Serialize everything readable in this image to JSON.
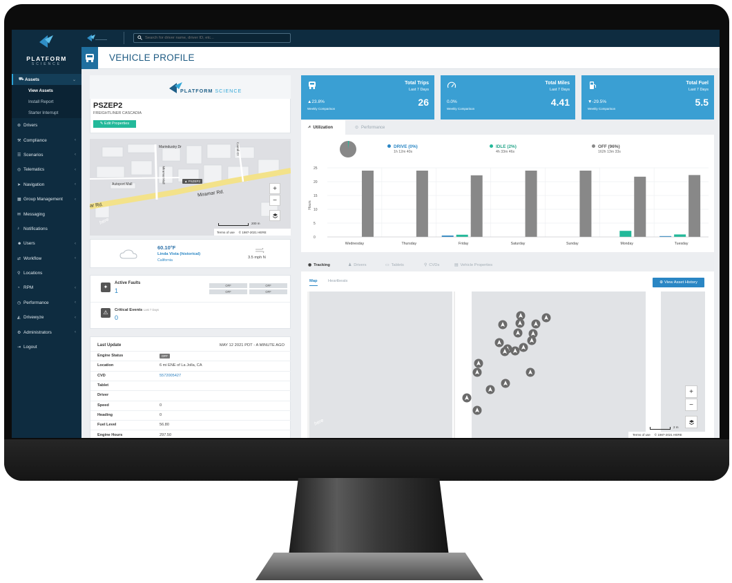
{
  "brand": {
    "title": "PLATFORM",
    "subtitle": "SCIENCE",
    "banner_main": "PLATFORM",
    "banner_accent": "SCIENCE"
  },
  "topbar": {
    "search_placeholder": "Search for driver name, driver ID, etc..."
  },
  "sidebar": {
    "items": [
      {
        "label": "Assets",
        "icon": "truck-icon",
        "chevron": "⌄"
      },
      {
        "label": "Drivers",
        "icon": "steering-icon",
        "chevron": ""
      },
      {
        "label": "Compliance",
        "icon": "gavel-icon",
        "chevron": "‹"
      },
      {
        "label": "Scenarios",
        "icon": "list-icon",
        "chevron": "‹"
      },
      {
        "label": "Telematics",
        "icon": "signal-icon",
        "chevron": "‹"
      },
      {
        "label": "Navigation",
        "icon": "navigation-icon",
        "chevron": "‹"
      },
      {
        "label": "Group Management",
        "icon": "grid-icon",
        "chevron": "‹"
      },
      {
        "label": "Messaging",
        "icon": "chat-icon",
        "chevron": ""
      },
      {
        "label": "Notifications",
        "icon": "bell-icon",
        "chevron": ""
      },
      {
        "label": "Users",
        "icon": "users-icon",
        "chevron": "‹"
      },
      {
        "label": "Workflow",
        "icon": "workflow-icon",
        "chevron": "‹"
      },
      {
        "label": "Locations",
        "icon": "pin-icon",
        "chevron": ""
      },
      {
        "label": "RPM",
        "icon": "gauge-icon",
        "chevron": "‹"
      },
      {
        "label": "Performance",
        "icon": "performance-icon",
        "chevron": "‹"
      },
      {
        "label": "Drivewyze",
        "icon": "drivewyze-icon",
        "chevron": "‹"
      },
      {
        "label": "Administrators",
        "icon": "admin-icon",
        "chevron": "‹"
      },
      {
        "label": "Logout",
        "icon": "logout-icon",
        "chevron": ""
      }
    ],
    "sub_items": [
      "View Assets",
      "Install Report",
      "Starter Interrupt"
    ]
  },
  "page": {
    "title": "VEHICLE PROFILE"
  },
  "vehicle": {
    "name": "PSZEP2",
    "model": "FREIGHTLINER CASCADIA",
    "edit_label": "Edit Properties"
  },
  "small_map": {
    "labels": [
      "Marindustry Dr",
      "Autoport Mall",
      "Miramar Rd.",
      "ar Rd.",
      "Carroll Ct",
      "Miramar Mall"
    ],
    "marker": "PSZEP2",
    "scale": "200 m",
    "terms": "Terms of use",
    "copyright": "© 1987-2021 HERE",
    "watermark": "here"
  },
  "weather": {
    "temp": "60.10°F",
    "location": "Linda Vista (historical)",
    "region": "California",
    "wind": "3.5 mph N"
  },
  "faults": {
    "active_label": "Active Faults",
    "active_count": "1",
    "critical_label": "Critical Events",
    "critical_sub": "Last 7 Days",
    "critical_count": "0",
    "badges": [
      "OFF",
      "OFF",
      "OFF",
      "OFF"
    ]
  },
  "info": {
    "header_key": "Last Update",
    "header_value": "MAY 12 2021 PDT - A MINUTE AGO",
    "rows": [
      {
        "key": "Engine Status",
        "value": "OFF"
      },
      {
        "key": "Location",
        "value": "6 mi ENE of La Jolla, CA"
      },
      {
        "key": "CVD",
        "value": "5572005427"
      },
      {
        "key": "Tablet",
        "value": ""
      },
      {
        "key": "Driver",
        "value": ""
      },
      {
        "key": "Speed",
        "value": "0"
      },
      {
        "key": "Heading",
        "value": "0"
      },
      {
        "key": "Fuel Level",
        "value": "56.80"
      },
      {
        "key": "Engine Hours",
        "value": "297.50"
      }
    ]
  },
  "tiles": [
    {
      "title": "Total Trips",
      "sub": "Last 7 Days",
      "value": "26",
      "pct": "▲23.8%",
      "cmp": "Weekly Comparison",
      "icon": "truck-icon"
    },
    {
      "title": "Total Miles",
      "sub": "Last 7 Days",
      "value": "4.41",
      "pct": "0.0%",
      "cmp": "Weekly Comparison",
      "icon": "speedometer-icon"
    },
    {
      "title": "Total Fuel",
      "sub": "Last 7 Days",
      "value": "5.5",
      "pct": "▼-29.5%",
      "cmp": "Weekly Comparison",
      "icon": "fuel-icon"
    }
  ],
  "chart_tabs": [
    "Utilization",
    "Performance"
  ],
  "utilization": {
    "drive_label": "DRIVE (0%)",
    "drive_time": "1h 12m 40s",
    "idle_label": "IDLE (2%)",
    "idle_time": "4h 33m 46s",
    "off_label": "OFF (96%)",
    "off_time": "162h 13m 33s"
  },
  "colors": {
    "drive": "#2a86c4",
    "idle": "#23b99a",
    "off": "#888888",
    "tile": "#3a9fd3",
    "sidebar": "#0e2c40"
  },
  "chart_data": {
    "type": "bar",
    "categories": [
      "Wednesday",
      "Thursday",
      "Friday",
      "Saturday",
      "Sunday",
      "Monday",
      "Tuesday"
    ],
    "series": [
      {
        "name": "DRIVE",
        "values": [
          0,
          0,
          0.5,
          0,
          0,
          0,
          0.3
        ]
      },
      {
        "name": "IDLE",
        "values": [
          0,
          0,
          0.8,
          0,
          0,
          2.2,
          0.9
        ]
      },
      {
        "name": "OFF",
        "values": [
          24,
          24,
          22.3,
          24,
          24,
          21.8,
          22.4
        ]
      }
    ],
    "ylabel": "Hours",
    "yticks": [
      0,
      5,
      10,
      15,
      20,
      25
    ],
    "ylim": [
      0,
      25
    ],
    "grid": true
  },
  "tracking_tabs": [
    "Tracking",
    "Drivers",
    "Tablets",
    "CVDs",
    "Vehicle Properties"
  ],
  "tracking_subtabs": [
    "Map",
    "Heartbeats"
  ],
  "tracking": {
    "history_button": "View Asset History",
    "scale": "2 m",
    "terms": "Terms of use",
    "copyright": "© 1987-2021 HERE",
    "watermark": "here"
  }
}
